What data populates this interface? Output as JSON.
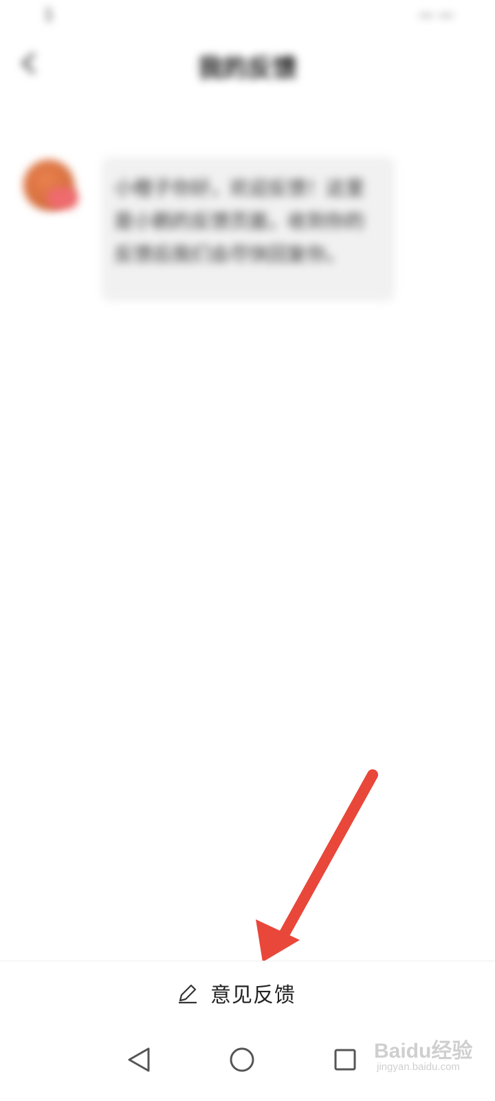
{
  "status_bar": {
    "left": "1",
    "right": "— —"
  },
  "header": {
    "title": "我的反馈"
  },
  "conversation": {
    "timestamp": "",
    "message": "小橙子你好，欢迎反馈！这里是小鹅的反馈页面，收到你的反馈后我们会尽快回复你。"
  },
  "feedback_bar": {
    "label": "意见反馈",
    "icon": "edit-icon"
  },
  "nav": {
    "back": "back-triangle-icon",
    "home": "home-circle-icon",
    "recents": "recents-square-icon"
  },
  "watermark": {
    "brand": "Baidu经验",
    "url": "jingyan.baidu.com"
  },
  "colors": {
    "annotation_arrow": "#e8473a",
    "text": "#222222"
  }
}
